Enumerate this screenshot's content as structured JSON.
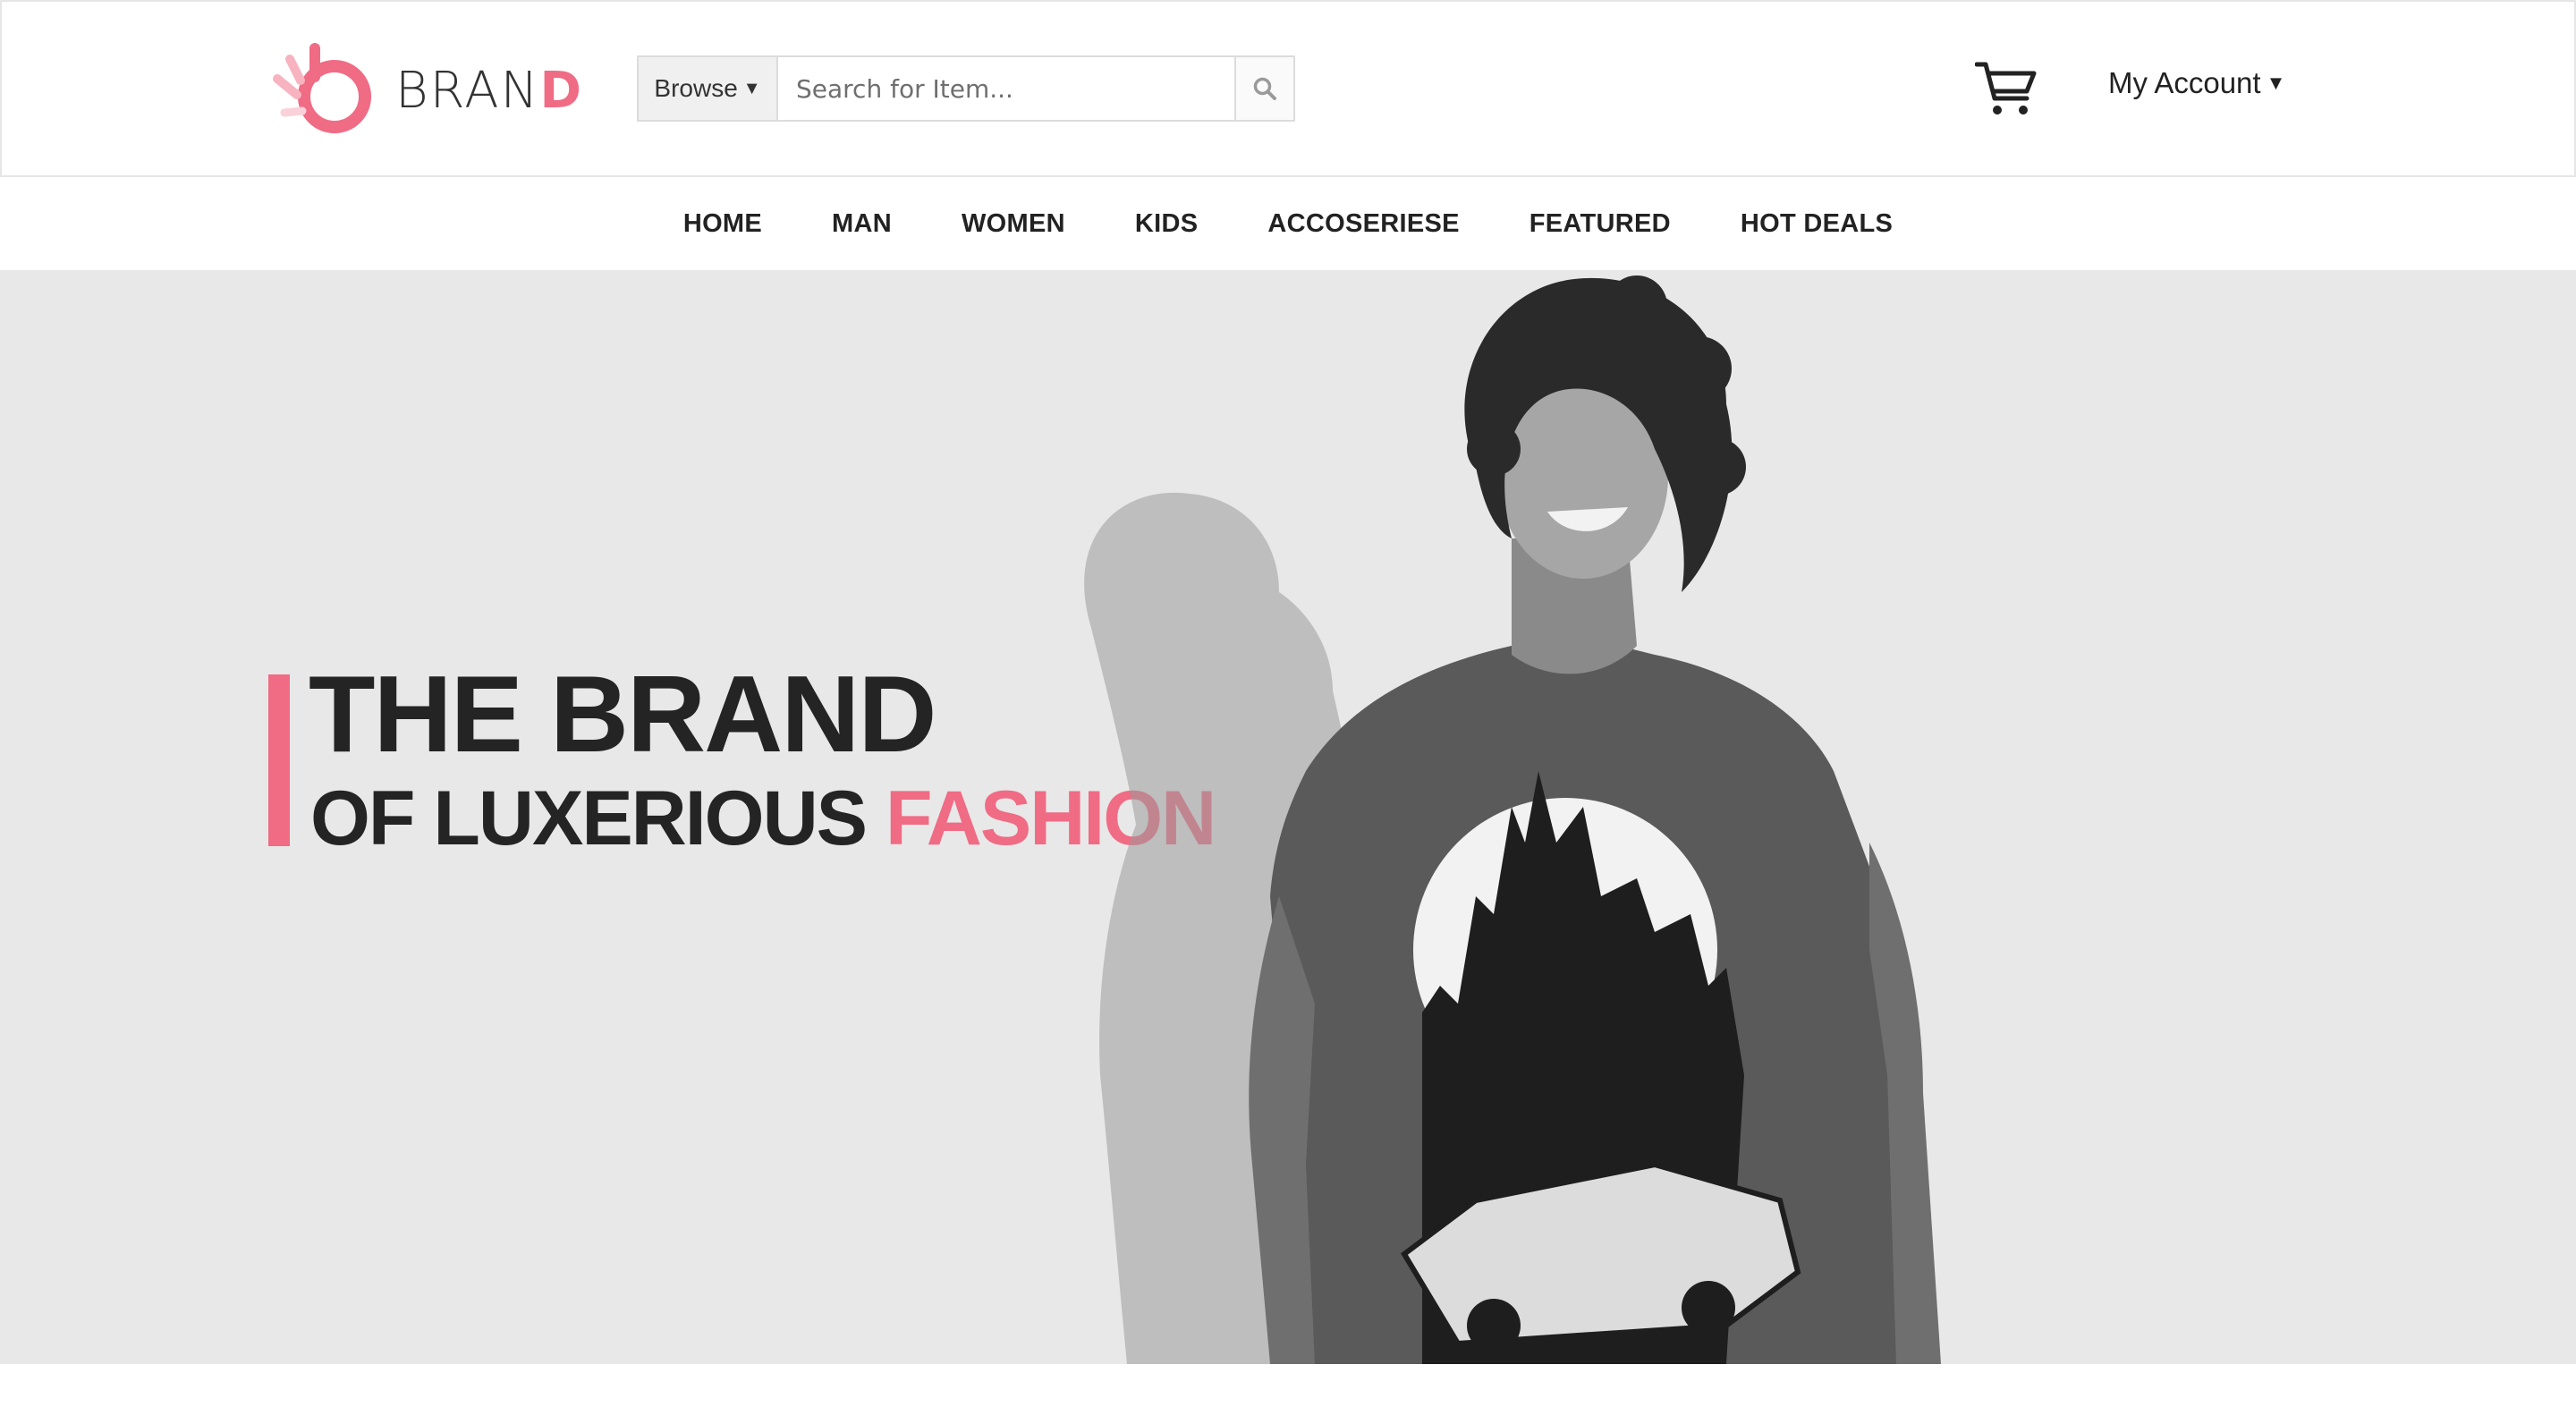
{
  "brand": {
    "name_main": "BRAN",
    "name_accent": "D",
    "accent_color": "#f06b84"
  },
  "search": {
    "browse_label": "Browse",
    "placeholder": "Search for Item...",
    "icon": "search-icon"
  },
  "header": {
    "account_label": "My Account",
    "cart_icon": "cart-icon"
  },
  "nav": {
    "items": [
      {
        "label": "HOME"
      },
      {
        "label": "MAN"
      },
      {
        "label": "WOMEN"
      },
      {
        "label": "KIDS"
      },
      {
        "label": "ACCOSERIESE"
      },
      {
        "label": "FEATURED"
      },
      {
        "label": "HOT DEALS"
      }
    ]
  },
  "hero": {
    "title": "THE BRAND",
    "subtitle_main": "OF LUXERIOUS ",
    "subtitle_accent": "FASHION",
    "background_color": "#e8e8e8"
  }
}
